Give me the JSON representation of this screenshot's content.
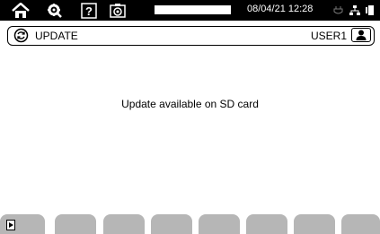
{
  "topbar": {
    "icons": [
      "home-icon",
      "settings-icon",
      "help-icon",
      "camera-icon"
    ],
    "progress": 1.0,
    "datetime": "08/04/21 12:28",
    "status_icons": [
      "power-plug-icon",
      "network-icon",
      "battery-icon"
    ]
  },
  "header": {
    "title": "UPDATE",
    "icon": "update-icon",
    "user": "USER1",
    "user_icon": "user-icon"
  },
  "main": {
    "message": "Update available on SD card"
  },
  "softkeys": {
    "first_icon": "play-icon"
  }
}
